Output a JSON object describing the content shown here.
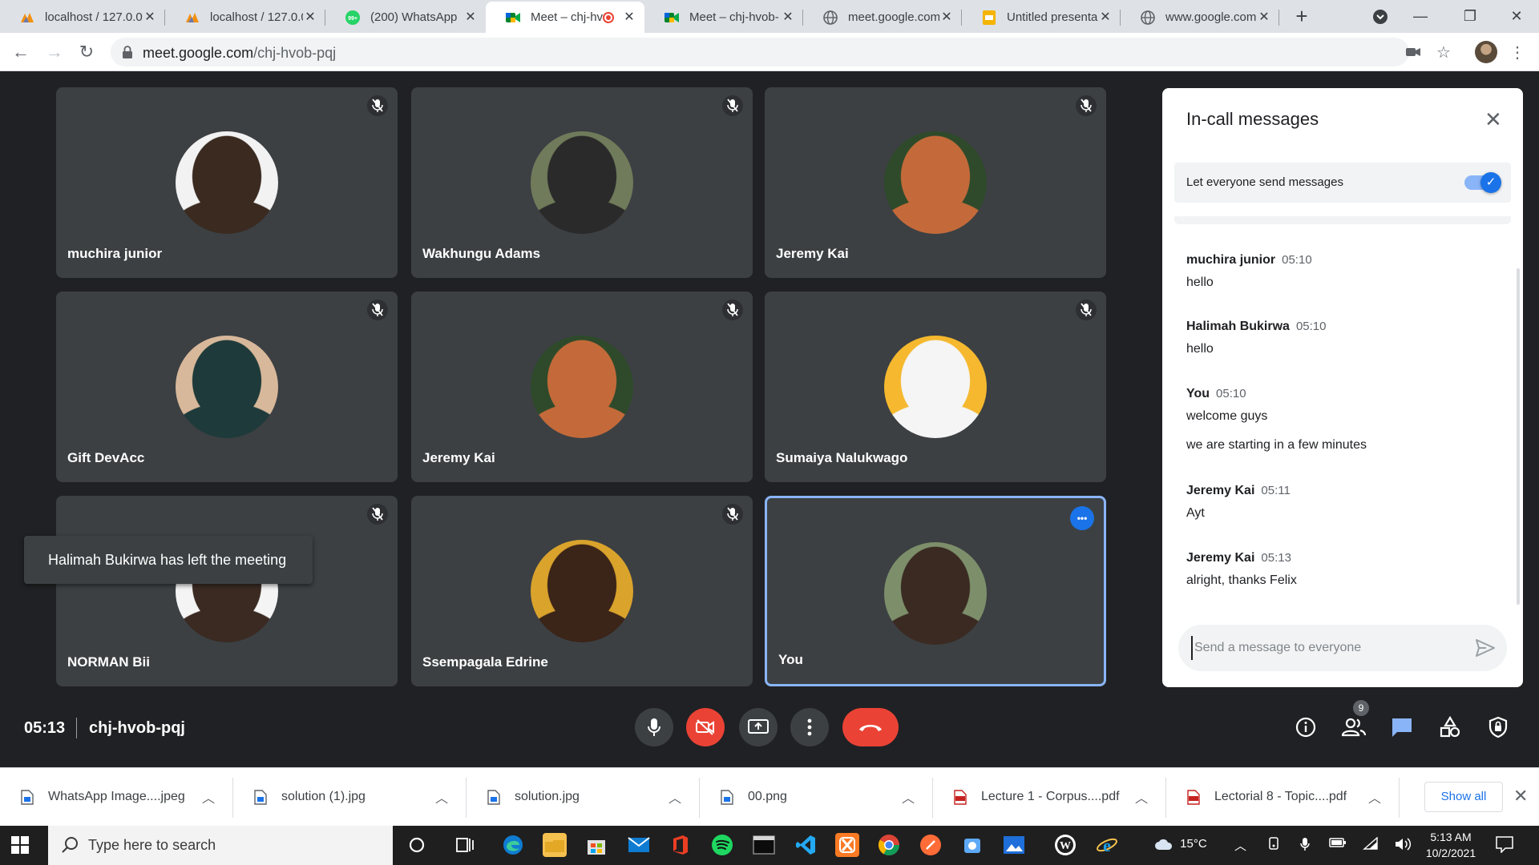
{
  "browser": {
    "tabs": [
      {
        "label": "localhost / 127.0.0",
        "icon": "phpmyadmin-icon",
        "active": false
      },
      {
        "label": "localhost / 127.0.0",
        "icon": "phpmyadmin-icon",
        "active": false
      },
      {
        "label": "(200) WhatsApp",
        "icon": "whatsapp-icon",
        "active": false,
        "badge": "99+"
      },
      {
        "label": "Meet – chj-hv",
        "icon": "google-meet-icon",
        "active": true,
        "recording": true
      },
      {
        "label": "Meet – chj-hvob-",
        "icon": "google-meet-icon",
        "active": false
      },
      {
        "label": "meet.google.com",
        "icon": "globe-icon",
        "active": false
      },
      {
        "label": "Untitled presenta",
        "icon": "google-slides-icon",
        "active": false
      },
      {
        "label": "www.google.com",
        "icon": "globe-icon",
        "active": false
      }
    ],
    "url_host": "meet.google.com",
    "url_path": "/chj-hvob-pqj"
  },
  "meet": {
    "participants": [
      {
        "name": "muchira junior",
        "muted": true,
        "avatar_colors": [
          "#f2f2f2",
          "#3a2a20"
        ]
      },
      {
        "name": "Wakhungu Adams",
        "muted": true,
        "avatar_colors": [
          "#6f7b5a",
          "#2b2a2a"
        ]
      },
      {
        "name": "Jeremy Kai",
        "muted": true,
        "avatar_colors": [
          "#2e4a2a",
          "#c46a3a"
        ]
      },
      {
        "name": "Gift DevAcc",
        "muted": true,
        "avatar_colors": [
          "#d8b89a",
          "#1e3a3a"
        ]
      },
      {
        "name": "Jeremy Kai",
        "muted": true,
        "avatar_colors": [
          "#2e4a2a",
          "#c46a3a"
        ]
      },
      {
        "name": "Sumaiya Nalukwago",
        "muted": true,
        "avatar_colors": [
          "#f5b82e",
          "#f5f5f5"
        ]
      },
      {
        "name": "NORMAN Bii",
        "muted": true,
        "avatar_colors": [
          "#f4f4f4",
          "#3a2a22"
        ]
      },
      {
        "name": "Ssempagala Edrine",
        "muted": true,
        "avatar_colors": [
          "#d9a32c",
          "#3b2418"
        ]
      },
      {
        "name": "You",
        "muted": false,
        "self": true,
        "avatar_colors": [
          "#7d8f6a",
          "#3a2a22"
        ]
      }
    ],
    "toast": "Halimah Bukirwa has left the meeting",
    "time": "05:13",
    "meeting_code": "chj-hvob-pqj",
    "people_count": "9"
  },
  "chat": {
    "title": "In-call messages",
    "permission_label": "Let everyone send messages",
    "permission_on": true,
    "messages": [
      {
        "sender": "muchira junior",
        "time": "05:10",
        "lines": [
          "hello"
        ]
      },
      {
        "sender": "Halimah Bukirwa",
        "time": "05:10",
        "lines": [
          "hello"
        ]
      },
      {
        "sender": "You",
        "time": "05:10",
        "lines": [
          "welcome guys",
          "we are starting in a few minutes"
        ]
      },
      {
        "sender": "Jeremy Kai",
        "time": "05:11",
        "lines": [
          "Ayt"
        ]
      },
      {
        "sender": "Jeremy Kai",
        "time": "05:13",
        "lines": [
          "alright, thanks Felix"
        ]
      }
    ],
    "input_placeholder": "Send a message to everyone"
  },
  "downloads": {
    "items": [
      {
        "name": "WhatsApp Image....jpeg",
        "type": "image"
      },
      {
        "name": "solution (1).jpg",
        "type": "image"
      },
      {
        "name": "solution.jpg",
        "type": "image"
      },
      {
        "name": "00.png",
        "type": "image"
      },
      {
        "name": "Lecture 1 - Corpus....pdf",
        "type": "pdf"
      },
      {
        "name": "Lectorial 8 - Topic....pdf",
        "type": "pdf"
      }
    ],
    "show_all": "Show all"
  },
  "taskbar": {
    "search_placeholder": "Type here to search",
    "weather": "15°C",
    "clock_time": "5:13 AM",
    "clock_date": "10/2/2021"
  },
  "colors": {
    "meet_bg": "#202124",
    "tile_bg": "#3c4043",
    "accent_blue": "#1a73e8",
    "end_call_red": "#ea4335"
  }
}
